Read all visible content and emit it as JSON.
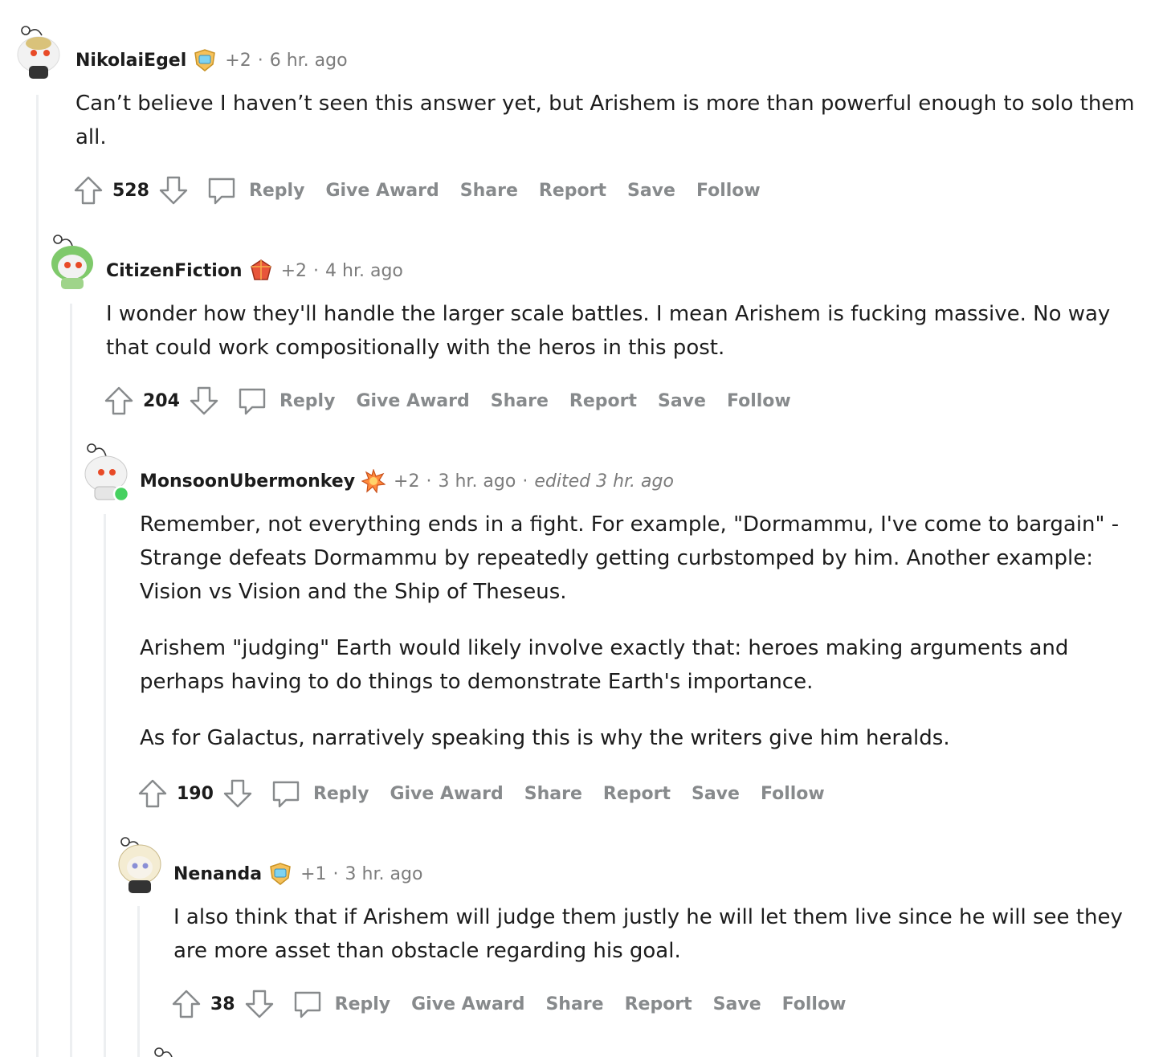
{
  "actions": {
    "reply": "Reply",
    "give_award": "Give Award",
    "share": "Share",
    "report": "Report",
    "save": "Save",
    "follow": "Follow"
  },
  "comments": [
    {
      "username": "NikolaiEgel",
      "award_icon": "award-badge-blue",
      "karma": "+2",
      "time": "6 hr. ago",
      "paragraphs": [
        "Can’t believe I haven’t seen this answer yet, but Arishem is more than powerful enough to solo them all."
      ],
      "score": "528"
    },
    {
      "username": "CitizenFiction",
      "award_icon": "award-gem-red",
      "karma": "+2",
      "time": "4 hr. ago",
      "paragraphs": [
        "I wonder how they'll handle the larger scale battles. I mean Arishem is fucking massive. No way that could work compositionally with the heros in this post."
      ],
      "score": "204"
    },
    {
      "username": "MonsoonUbermonkey",
      "award_icon": "award-burst-orange",
      "karma": "+2",
      "time": "3 hr. ago",
      "edited": "edited 3 hr. ago",
      "paragraphs": [
        "Remember, not everything ends in a fight. For example, \"Dormammu, I've come to bargain\" - Strange defeats Dormammu by repeatedly getting curbstomped by him. Another example: Vision vs Vision and the Ship of Theseus.",
        "Arishem \"judging\" Earth would likely involve exactly that: heroes making arguments and perhaps having to do things to demonstrate Earth's importance.",
        "As for Galactus, narratively speaking this is why the writers give him heralds."
      ],
      "score": "190"
    },
    {
      "username": "Nenanda",
      "award_icon": "award-badge-blue",
      "karma": "+1",
      "time": "3 hr. ago",
      "paragraphs": [
        "I also think that if Arishem will judge them justly he will let them live since he will see they are more asset than obstacle regarding his goal."
      ],
      "score": "38"
    }
  ],
  "colors": {
    "thread_line": "#edeff1",
    "muted": "#7c7c7c",
    "action": "#878a8c",
    "online": "#46d160"
  }
}
